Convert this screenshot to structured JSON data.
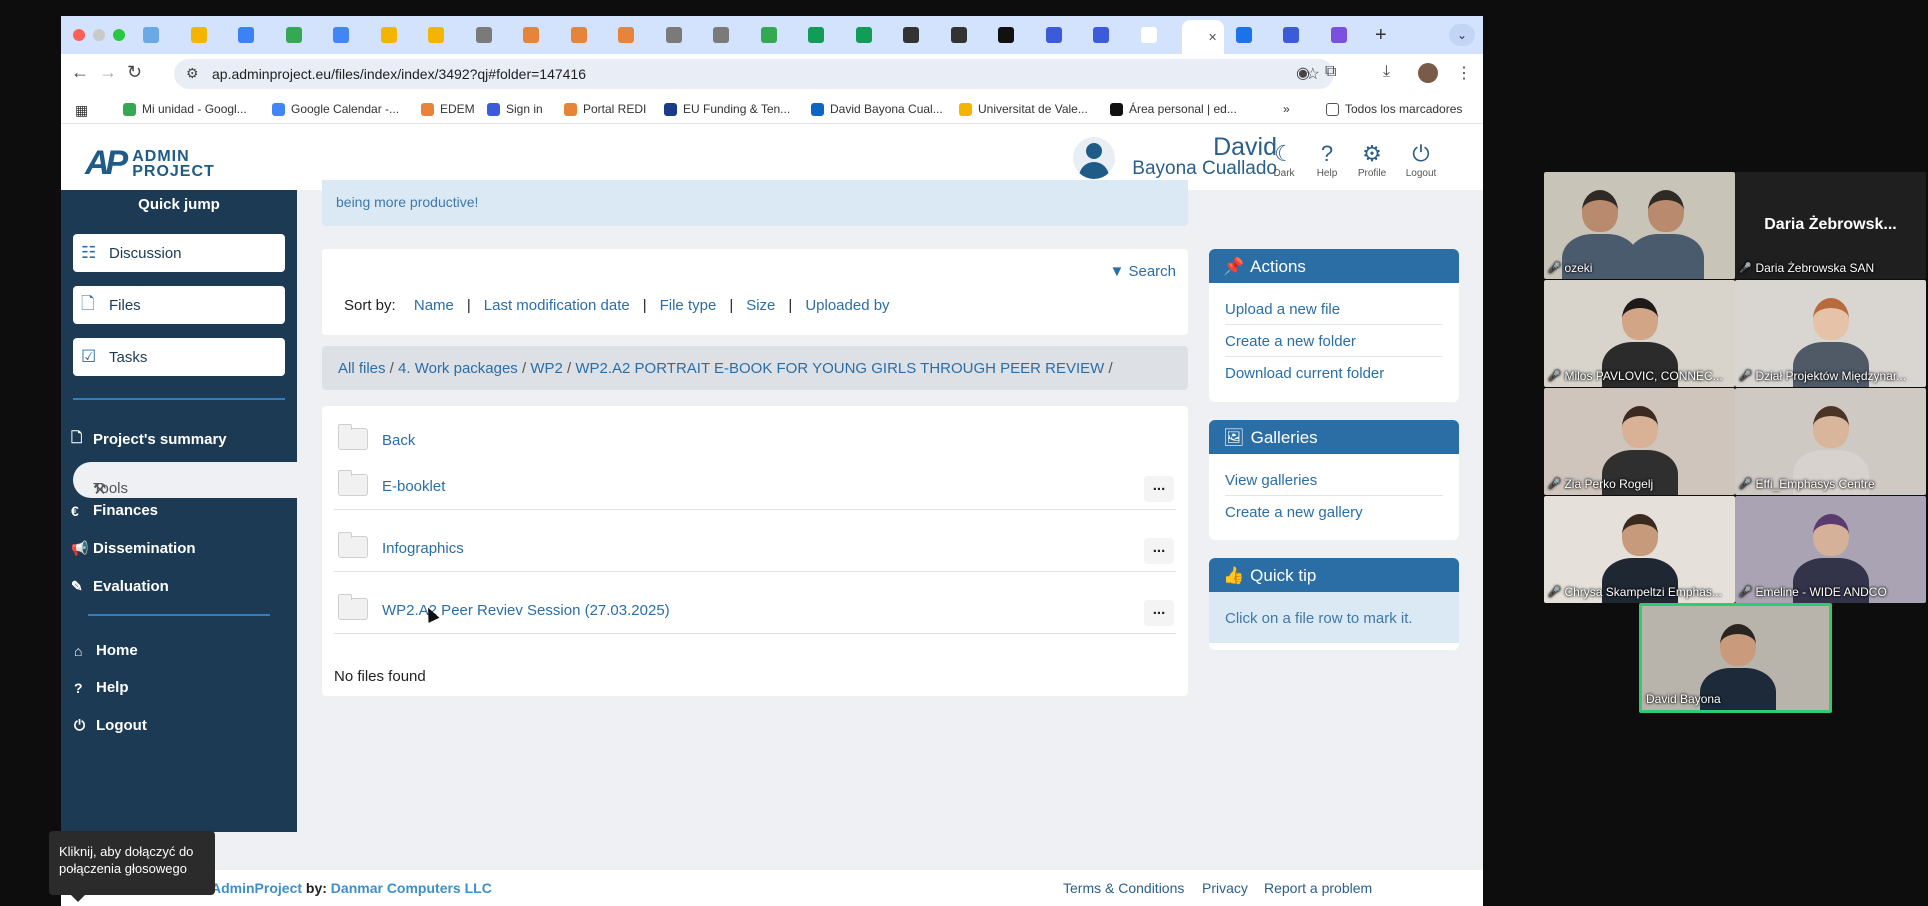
{
  "browser": {
    "tabs_count": 26,
    "active_tab_index": 22,
    "url": "ap.adminproject.eu/files/index/index/3492?qj#folder=147416",
    "bookmarks": [
      "Mi unidad - Googl...",
      "Google Calendar -...",
      "EDEM",
      "Sign in",
      "Portal REDI",
      "EU Funding & Ten...",
      "David Bayona Cual...",
      "Universitat de Vale...",
      "Área personal | ed..."
    ],
    "bookmarks_more": "»",
    "all_bookmarks": "Todos los marcadores"
  },
  "app": {
    "logo_mark": "AP",
    "logo_line1": "ADMIN",
    "logo_line2": "PROJECT",
    "user_first": "David",
    "user_last": "Bayona Cuallado",
    "header_icons": [
      {
        "glyph": "☾",
        "label": "Dark",
        "icon": "moon-icon"
      },
      {
        "glyph": "?",
        "label": "Help",
        "icon": "help-icon"
      },
      {
        "glyph": "⚙",
        "label": "Profile",
        "icon": "profile-icon"
      },
      {
        "glyph": "⏻",
        "label": "Logout",
        "icon": "power-icon"
      }
    ]
  },
  "sidebar": {
    "quick_jump": "Quick jump",
    "quick_buttons": [
      {
        "label": "Discussion",
        "glyph": "☷"
      },
      {
        "label": "Files",
        "glyph": "🗋"
      },
      {
        "label": "Tasks",
        "glyph": "☑"
      }
    ],
    "project_summary": "Project's summary",
    "tools": "Tools",
    "items": [
      "Finances",
      "Dissemination",
      "Evaluation"
    ],
    "bottom_items": [
      "Home",
      "Help",
      "Logout"
    ]
  },
  "main": {
    "banner_text": "being more productive!",
    "search": "Search",
    "sort_by": "Sort by:",
    "sort_options": [
      "Name",
      "Last modification date",
      "File type",
      "Size",
      "Uploaded by"
    ],
    "breadcrumb": [
      "All files",
      "4. Work packages",
      "WP2",
      "WP2.A2 PORTRAIT E-BOOK FOR YOUNG GIRLS THROUGH PEER REVIEW"
    ],
    "back": "Back",
    "folders": [
      "E-booklet",
      "Infographics",
      "WP2.A2 Peer Reviev Session (27.03.2025)"
    ],
    "more_label": "...",
    "no_files": "No files found"
  },
  "panels": {
    "actions_title": "Actions",
    "actions_links": [
      "Upload a new file",
      "Create a new folder",
      "Download current folder"
    ],
    "galleries_title": "Galleries",
    "galleries_links": [
      "View galleries",
      "Create a new gallery"
    ],
    "tip_title": "Quick tip",
    "tip_text": "Click on a file row to mark it."
  },
  "footer": {
    "credit_prefix": "",
    "credit_app": "AdminProject",
    "credit_by": " by: ",
    "credit_company": "Danmar Computers LLC",
    "links": [
      "Terms & Conditions",
      "Privacy",
      "Report a problem"
    ]
  },
  "tooltip": "Kliknij, aby dołączyć do połączenia głosowego",
  "meeting": {
    "participants": [
      "ozeki",
      "Daria Żebrowska SAN",
      "Milos PAVLOVIC, CONNEC...",
      "Dział Projektów Międzynar...",
      "Zia Perko Rogelj",
      "Effi_Emphasys Centre",
      "Chrysa Skampeltzi Emphas...",
      "Emeline - WIDE ANDCO",
      "David Bayona"
    ],
    "daria_placeholder": "Daria  Żebrowsk..."
  },
  "colors": {
    "brand": "#1d3a55",
    "accent": "#2b6ea6",
    "active_speaker": "#2ecc71"
  }
}
